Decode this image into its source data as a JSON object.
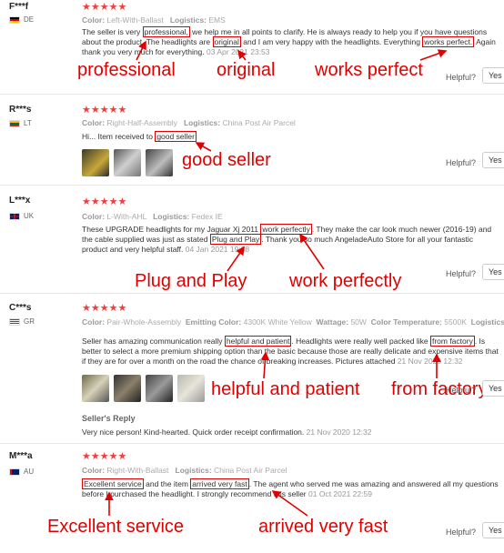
{
  "reviews": [
    {
      "reviewer": "F***f",
      "country": "DE",
      "stars": "★★★★★",
      "color_label": "Color:",
      "color_value": "Left-With-Ballast",
      "logistics_label": "Logistics:",
      "logistics_value": "EMS",
      "text_a": "The seller is very ",
      "hl_1": "professional,",
      "text_b": " we help me in all points to clarify. He is always ready to help you if you have questions about the product. The headlights are ",
      "hl_2": "original",
      "text_c": " and I am very happy with the headlights. Everything ",
      "hl_3": "works perfect.",
      "text_d": " Again thank you very much for everything.",
      "date": "03 Apr 2021 23:53",
      "helpful": "Helpful?",
      "yes": "Yes (",
      "annotations": [
        "professional",
        "original",
        "works perfect"
      ]
    },
    {
      "reviewer": "R***s",
      "country": "LT",
      "stars": "★★★★★",
      "color_label": "Color:",
      "color_value": "Right-Half-Assembly",
      "logistics_label": "Logistics:",
      "logistics_value": "China Post Air Parcel",
      "text_a": "Hi... Item received to ",
      "hl_1": "good seller",
      "helpful": "Helpful?",
      "yes": "Yes (",
      "annotations": [
        "good seller"
      ]
    },
    {
      "reviewer": "L***x",
      "country": "UK",
      "stars": "★★★★★",
      "color_label": "Color:",
      "color_value": "L-With-AHL",
      "logistics_label": "Logistics:",
      "logistics_value": "Fedex IE",
      "text_a": "These UPGRADE headlights for my Jaguar Xj 2011 ",
      "hl_1": "work perfectly",
      "text_b": ". They make the car look much newer (2016-19) and the cable supplied was just as stated ",
      "hl_2": "Plug and Play",
      "text_c": ". Thank you so much AngeladeAuto Store for all your fantastic product and very helpful staff.",
      "date": "04 Jan 2021 19:38",
      "helpful": "Helpful?",
      "yes": "Yes (",
      "annotations": [
        "Plug and Play",
        "work perfectly"
      ]
    },
    {
      "reviewer": "C***s",
      "country": "GR",
      "stars": "★★★★★",
      "color_label": "Color:",
      "color_value": "Pair-Whole-Assembly",
      "emitting_label": "Emitting Color:",
      "emitting_value": "4300K White Yellow",
      "wattage_label": "Wattage:",
      "wattage_value": "50W",
      "temp_label": "Color Temperature:",
      "temp_value": "5500K",
      "logistics_label": "Logistics",
      "text_a": "Seller has amazing communication really ",
      "hl_1": "helpful and patient",
      "text_b": ". Headlights were really well packed like ",
      "hl_2": "from factory",
      "text_c": ". Is better to select a more premium shipping option than the basic because those are really delicate and expensive items that if they are for over a month on the road the chance of breaking increases. Pictures attached",
      "date": "21 Nov 2020 12:32",
      "seller_reply_title": "Seller's Reply",
      "seller_reply": "Very nice person! Kind-hearted. Quick order receipt confirmation.",
      "seller_reply_date": "21 Nov 2020 12:32",
      "helpful": "Helpful?",
      "yes": "Yes (",
      "annotations": [
        "helpful and patient",
        "from factory"
      ]
    },
    {
      "reviewer": "M***a",
      "country": "AU",
      "stars": "★★★★★",
      "color_label": "Color:",
      "color_value": "Right-With-Ballast",
      "logistics_label": "Logistics:",
      "logistics_value": "China Post Air Parcel",
      "hl_1": "Excellent service",
      "text_a": " and the item ",
      "hl_2": "arrived very fast",
      "text_b": ". The agent who served me was amazing and answered all my questions before I purchased the headlight. I strongly recommend this seller",
      "date": "01 Oct 2021 22:59",
      "helpful": "Helpful?",
      "yes": "Yes (",
      "annotations": [
        "Excellent service",
        "arrived very fast"
      ]
    }
  ],
  "colors": {
    "annotation_red": "#e00000",
    "star_red": "#f03e3e"
  }
}
